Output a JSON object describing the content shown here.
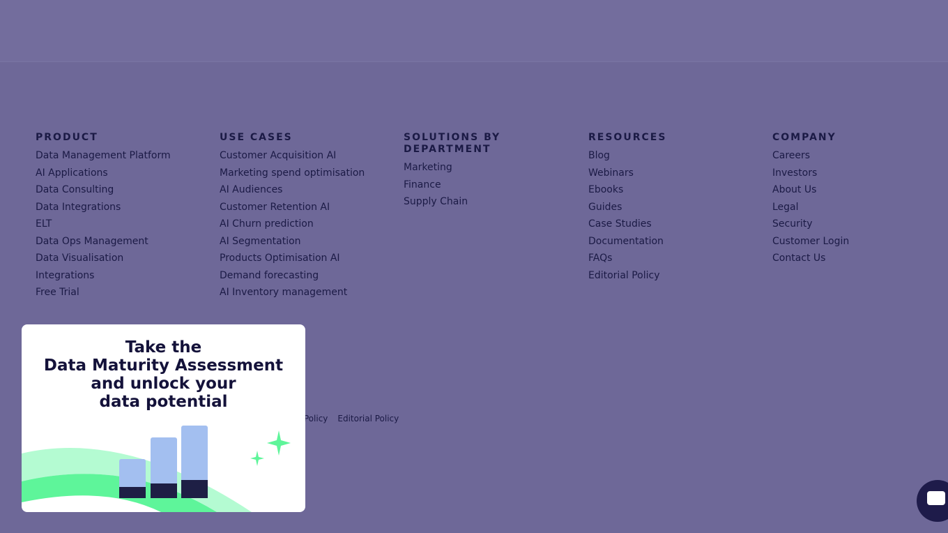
{
  "columns": [
    {
      "title": "PRODUCT",
      "links": [
        "Data Management Platform",
        "AI Applications",
        "Data Consulting",
        "Data Integrations",
        "ELT",
        "Data Ops Management",
        "Data Visualisation",
        "Integrations",
        "Free Trial"
      ]
    },
    {
      "title": "USE CASES",
      "links": [
        "Customer Acquisition AI",
        "Marketing spend optimisation",
        "AI Audiences",
        "Customer Retention AI",
        "AI Churn prediction",
        "AI Segmentation",
        "Products Optimisation AI",
        "Demand forecasting",
        "AI Inventory management"
      ]
    },
    {
      "title": "SOLUTIONS BY DEPARTMENT",
      "links": [
        "Marketing",
        "Finance",
        "Supply Chain"
      ]
    },
    {
      "title": "RESOURCES",
      "links": [
        "Blog",
        "Webinars",
        "Ebooks",
        "Guides",
        "Case Studies",
        "Documentation",
        "FAQs",
        "Editorial Policy"
      ]
    },
    {
      "title": "COMPANY",
      "links": [
        "Careers",
        "Investors",
        "About Us",
        "Legal",
        "Security",
        "Customer Login",
        "Contact Us"
      ]
    }
  ],
  "legal_links": [
    "ta Policy",
    "Editorial Policy"
  ],
  "popup": {
    "lines": [
      "Take the",
      "Data Maturity Assessment",
      "and unlock your",
      "data potential"
    ]
  },
  "colors": {
    "background": "#6e6898",
    "text": "#1b1a45",
    "accent_green": "#5ef59a",
    "bar_blue": "#a3bff0"
  },
  "chat_icon": "chat-bubble-icon"
}
